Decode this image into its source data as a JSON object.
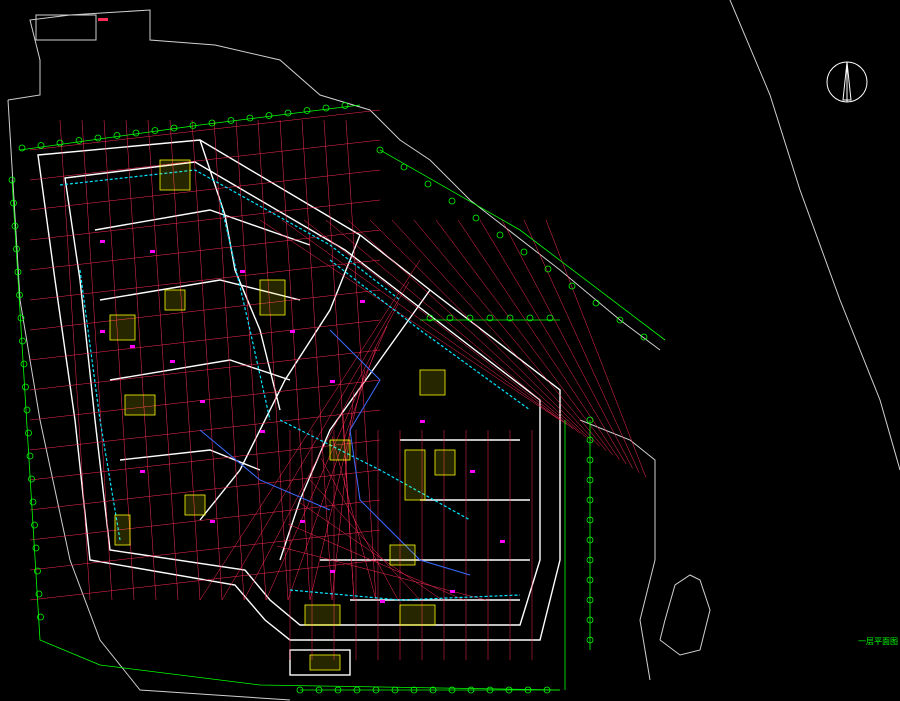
{
  "drawing": {
    "background": "#000000",
    "colors": {
      "grid_axis": "#ff2a55",
      "dimension": "#00ff00",
      "walls": "#ffffff",
      "site_boundary": "#cfcfcf",
      "pipe": "#00e5ff",
      "equipment": "#ffff00",
      "tag": "#ff00ff",
      "blue_line": "#3a6bff"
    },
    "north_arrow_icon": "north-arrow-icon",
    "title_block": {
      "label": "一层平面图"
    }
  }
}
